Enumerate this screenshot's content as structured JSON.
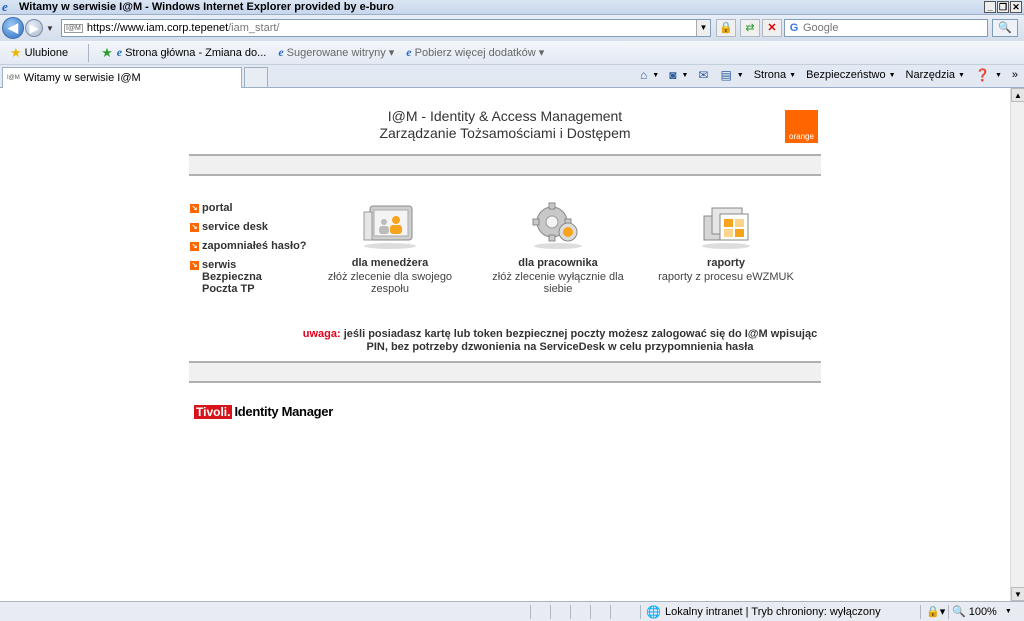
{
  "window": {
    "title": "Witamy w serwisie I@M - Windows Internet Explorer provided by e-buro",
    "buttons": [
      "_",
      "❐",
      "✕"
    ]
  },
  "nav": {
    "url_main": "https://www.iam.corp.tepenet",
    "url_path": "/iam_start/",
    "search_placeholder": "Google"
  },
  "favorites": {
    "label": "Ulubione",
    "items": [
      {
        "label": "Strona główna - Zmiana do..."
      },
      {
        "label": "Sugerowane witryny ▾"
      },
      {
        "label": "Pobierz więcej dodatków ▾"
      }
    ]
  },
  "tab": {
    "title": "Witamy w serwisie I@M"
  },
  "commands": {
    "page": "Strona",
    "safety": "Bezpieczeństwo",
    "tools": "Narzędzia"
  },
  "page": {
    "title_line1": "I@M - Identity & Access Management",
    "title_line2": "Zarządzanie Tożsamościami i Dostępem",
    "logo": "orange",
    "menu": [
      {
        "label": "portal"
      },
      {
        "label": "service desk"
      },
      {
        "label": "zapomniałeś hasło?"
      },
      {
        "label": "serwis Bezpieczna Poczta TP"
      }
    ],
    "tiles": [
      {
        "title": "dla menedżera",
        "subtitle": "złóż zlecenie dla swojego zespołu"
      },
      {
        "title": "dla pracownika",
        "subtitle": "złóż zlecenie wyłącznie dla siebie"
      },
      {
        "title": "raporty",
        "subtitle": "raporty z procesu eWZMUK"
      }
    ],
    "note_label": "uwaga:",
    "note_text": " jeśli posiadasz kartę lub token bezpiecznej poczty możesz zalogować się do I@M wpisując PIN, bez potrzeby dzwonienia na ServiceDesk w celu przypomnienia hasła",
    "tivoli_brand": "Tivoli.",
    "tivoli_product": "Identity Manager"
  },
  "status": {
    "zone": "Lokalny intranet | Tryb chroniony: wyłączony",
    "zoom": "100%"
  }
}
